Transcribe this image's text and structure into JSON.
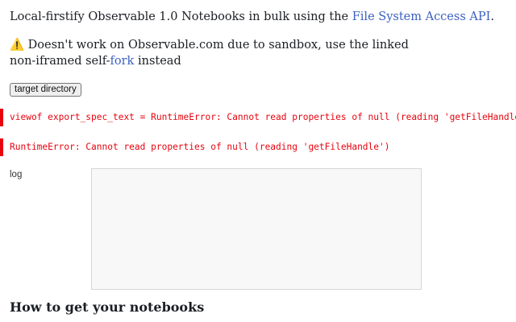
{
  "intro": {
    "prefix": "Local-firstify Observable 1.0 Notebooks in bulk using the ",
    "link": "File System Access API",
    "suffix": "."
  },
  "warning": {
    "icon": "⚠️",
    "text_before": " Doesn't work on Observable.com due to sandbox, use the linked non-iframed self-",
    "link": "fork",
    "text_after": " instead"
  },
  "target_directory_button": "target directory",
  "errors": [
    "viewof export_spec_text = RuntimeError: Cannot read properties of null (reading 'getFileHandle')",
    "RuntimeError: Cannot read properties of null (reading 'getFileHandle')"
  ],
  "log": {
    "label": "log",
    "value": ""
  },
  "section_heading": "How to get your notebooks",
  "colors": {
    "link": "#3b5fc0",
    "error": "#e7040f"
  }
}
